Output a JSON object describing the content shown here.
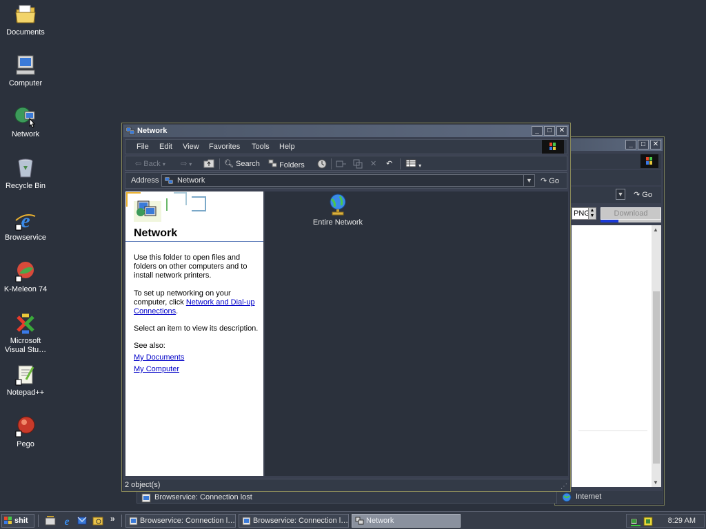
{
  "desktop": {
    "icons": [
      {
        "label": "Documents",
        "icon": "folder-icon"
      },
      {
        "label": "Computer",
        "icon": "computer-icon"
      },
      {
        "label": "Network",
        "icon": "network-icon"
      },
      {
        "label": "Recycle Bin",
        "icon": "recycle-bin-icon"
      },
      {
        "label": "Browservice",
        "icon": "ie-icon"
      },
      {
        "label": "K-Meleon 74",
        "icon": "kmeleon-icon"
      },
      {
        "label": "Microsoft Visual Stu…",
        "icon": "visual-studio-icon"
      },
      {
        "label": "Notepad++",
        "icon": "notepadpp-icon"
      },
      {
        "label": "Pego",
        "icon": "pego-icon"
      }
    ]
  },
  "bg_window": {
    "go_label": "Go",
    "format_value": "PNG",
    "download_label": "Download",
    "status_text": "Browservice: Connection lost",
    "zone_text": "Internet",
    "download_progress": 0.3
  },
  "network_window": {
    "title": "Network",
    "menu": [
      "File",
      "Edit",
      "View",
      "Favorites",
      "Tools",
      "Help"
    ],
    "toolbar": {
      "back_label": "Back",
      "search_label": "Search",
      "folders_label": "Folders"
    },
    "address": {
      "label": "Address",
      "value": "Network",
      "go_label": "Go"
    },
    "left_pane": {
      "heading": "Network",
      "para1": "Use this folder to open files and folders on other computers and to install network printers.",
      "para2_prefix": "To set up networking on your computer, click ",
      "para2_link": "Network and Dial-up Connections",
      "para2_suffix": ".",
      "para3": "Select an item to view its description.",
      "see_also": "See also:",
      "link1": "My Documents",
      "link2": "My Computer"
    },
    "items": [
      {
        "label": "Entire Network",
        "icon": "globe-icon"
      }
    ],
    "status": "2 object(s)"
  },
  "taskbar": {
    "start_label": "shit",
    "chevron": "»",
    "tasks": [
      {
        "label": "Browservice: Connection l…"
      },
      {
        "label": "Browservice: Connection l…"
      },
      {
        "label": "Network"
      }
    ],
    "clock": "8:29 AM"
  },
  "colors": {
    "desktop": "#2b313c",
    "window_frame": "#7a7f5a",
    "link": "#0000c8"
  }
}
